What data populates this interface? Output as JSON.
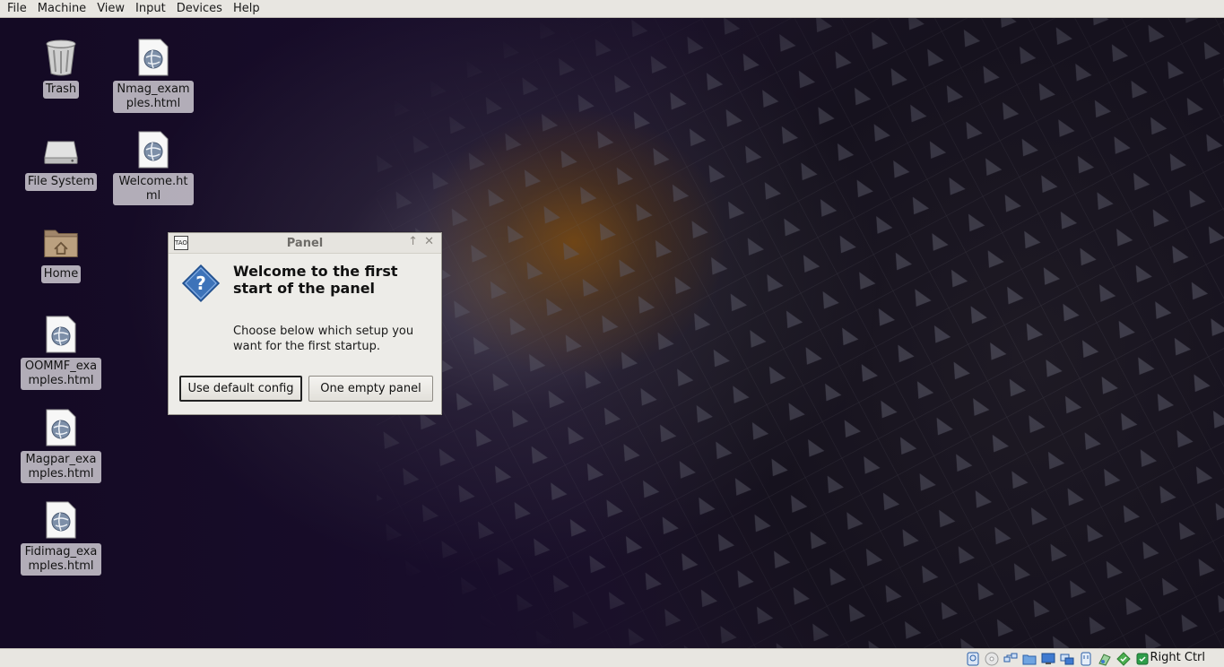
{
  "menubar": {
    "items": [
      {
        "label": "File"
      },
      {
        "label": "Machine"
      },
      {
        "label": "View"
      },
      {
        "label": "Input"
      },
      {
        "label": "Devices"
      },
      {
        "label": "Help"
      }
    ]
  },
  "desktop": {
    "icons": [
      {
        "label": "Trash",
        "icon": "trash-icon"
      },
      {
        "label": "Nmag_examples.html",
        "icon": "html-file-icon"
      },
      {
        "label": "File System",
        "icon": "drive-icon"
      },
      {
        "label": "Welcome.html",
        "icon": "html-file-icon"
      },
      {
        "label": "Home",
        "icon": "home-folder-icon"
      },
      {
        "label": "OOMMF_examples.html",
        "icon": "html-file-icon"
      },
      {
        "label": "Magpar_examples.html",
        "icon": "html-file-icon"
      },
      {
        "label": "Fidimag_examples.html",
        "icon": "html-file-icon"
      }
    ]
  },
  "dialog": {
    "title": "Panel",
    "app_icon_text": "TAO",
    "heading": "Welcome to the first start of the panel",
    "body": "Choose below which setup you want for the first startup.",
    "buttons": {
      "default_config": "Use default config",
      "empty_panel": "One empty panel"
    },
    "icon": "question-icon"
  },
  "statusbar": {
    "host_key": "Right Ctrl",
    "icons": [
      "hard-disk-icon",
      "optical-drive-icon",
      "network-icon",
      "shared-folder-icon",
      "display-icon",
      "video-capture-icon",
      "usb-icon",
      "cpu-icon",
      "mouse-integration-icon",
      "host-key-icon"
    ]
  },
  "colors": {
    "menubar_bg": "#e8e6e1",
    "desktop_bg": "#160c26",
    "dialog_bg": "#edece8",
    "question_blue": "#3d73b9"
  }
}
